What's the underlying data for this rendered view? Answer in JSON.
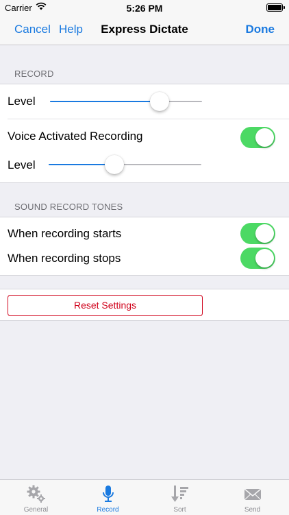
{
  "status": {
    "carrier": "Carrier",
    "time": "5:26 PM"
  },
  "nav": {
    "cancel": "Cancel",
    "help": "Help",
    "title": "Express Dictate",
    "done": "Done"
  },
  "record_section": {
    "header": "RECORD",
    "level_label": "Level",
    "level_value": 0.72,
    "voice_activated_label": "Voice Activated Recording",
    "voice_activated_on": true,
    "voice_level_label": "Level",
    "voice_level_value": 0.43
  },
  "tones_section": {
    "header": "SOUND RECORD TONES",
    "starts_label": "When recording starts",
    "starts_on": true,
    "stops_label": "When recording stops",
    "stops_on": true
  },
  "reset": {
    "label": "Reset Settings"
  },
  "tabs": [
    {
      "label": "General",
      "icon": "gears-icon",
      "active": false
    },
    {
      "label": "Record",
      "icon": "microphone-icon",
      "active": true
    },
    {
      "label": "Sort",
      "icon": "sort-icon",
      "active": false
    },
    {
      "label": "Send",
      "icon": "envelope-icon",
      "active": false
    }
  ],
  "colors": {
    "accent": "#1a7ae0",
    "toggle_on": "#4cd964",
    "destructive": "#d0021b"
  }
}
